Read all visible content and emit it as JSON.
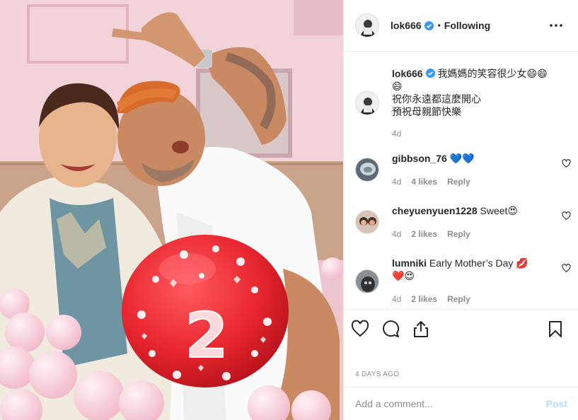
{
  "header": {
    "username": "lok666",
    "separator": "•",
    "follow_label": "Following",
    "more_icon": "more-horizontal-icon"
  },
  "caption": {
    "username": "lok666",
    "text": "我媽媽的笑容很少女😄😄😄",
    "line2": "祝你永遠都這麼開心",
    "line3": "預祝母親節快樂",
    "time": "4d"
  },
  "comments": [
    {
      "username": "gibbson_76",
      "text": "💙💙",
      "time": "4d",
      "likes": "4 likes",
      "reply": "Reply"
    },
    {
      "username": "cheyuenyuen1228",
      "text": "Sweet😍",
      "time": "4d",
      "likes": "2 likes",
      "reply": "Reply"
    },
    {
      "username": "lumniki",
      "text": "Early Mother’s Day 💋",
      "text2": "❤️😍",
      "time": "4d",
      "likes": "2 likes",
      "reply": "Reply"
    }
  ],
  "actions": {
    "like_icon": "heart-icon",
    "comment_icon": "comment-icon",
    "share_icon": "share-icon",
    "save_icon": "bookmark-icon",
    "posted": "4 DAYS AGO"
  },
  "add_comment": {
    "placeholder": "Add a comment...",
    "post_label": "Post"
  },
  "photo": {
    "balloon_number": "2"
  },
  "colors": {
    "verified": "#3897f0",
    "text": "#262626",
    "muted": "#8e8e8e",
    "post_disabled": "#b3dbff",
    "balloon": "#e8262f"
  }
}
